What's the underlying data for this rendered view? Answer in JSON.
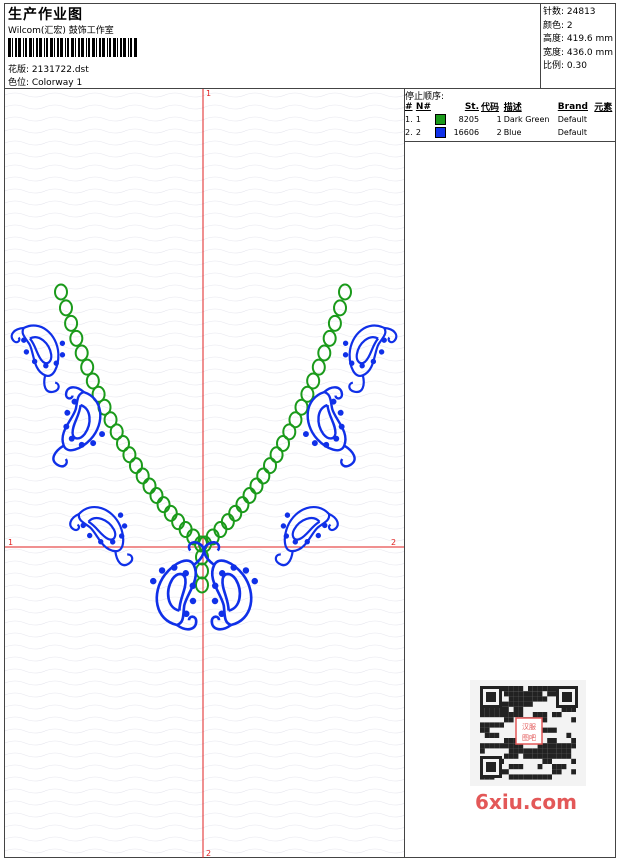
{
  "header": {
    "title": "生产作业图",
    "subtitle": "Wilcom(汇宏) 鼓饰工作室",
    "design_file_label": "花版: 2131722.dst",
    "colorway_label": "色位: Colorway 1"
  },
  "specs": {
    "stitches": "针数: 24813",
    "colors": "颜色: 2",
    "height": "高度: 419.6 mm",
    "width": "宽度: 436.0 mm",
    "scale": "比例: 0.30"
  },
  "stop_sequence": {
    "title": "停止顺序:",
    "columns": [
      "#",
      "N#",
      "St.",
      "代码",
      "描述",
      "Brand",
      "元素"
    ],
    "rows": [
      {
        "index": "1.",
        "needle": "1",
        "color": "#1a9a1a",
        "stitches": "8205",
        "code": "1",
        "description": "Dark Green",
        "brand": "Default"
      },
      {
        "index": "2.",
        "needle": "2",
        "color": "#1030e8",
        "stitches": "16606",
        "code": "2",
        "description": "Blue",
        "brand": "Default"
      }
    ]
  },
  "axes": {
    "top": "1",
    "left": "1",
    "right": "2",
    "bottom": "2"
  },
  "watermark": {
    "text": "6xiu.com",
    "qr_stamp": "汉服图吧"
  }
}
